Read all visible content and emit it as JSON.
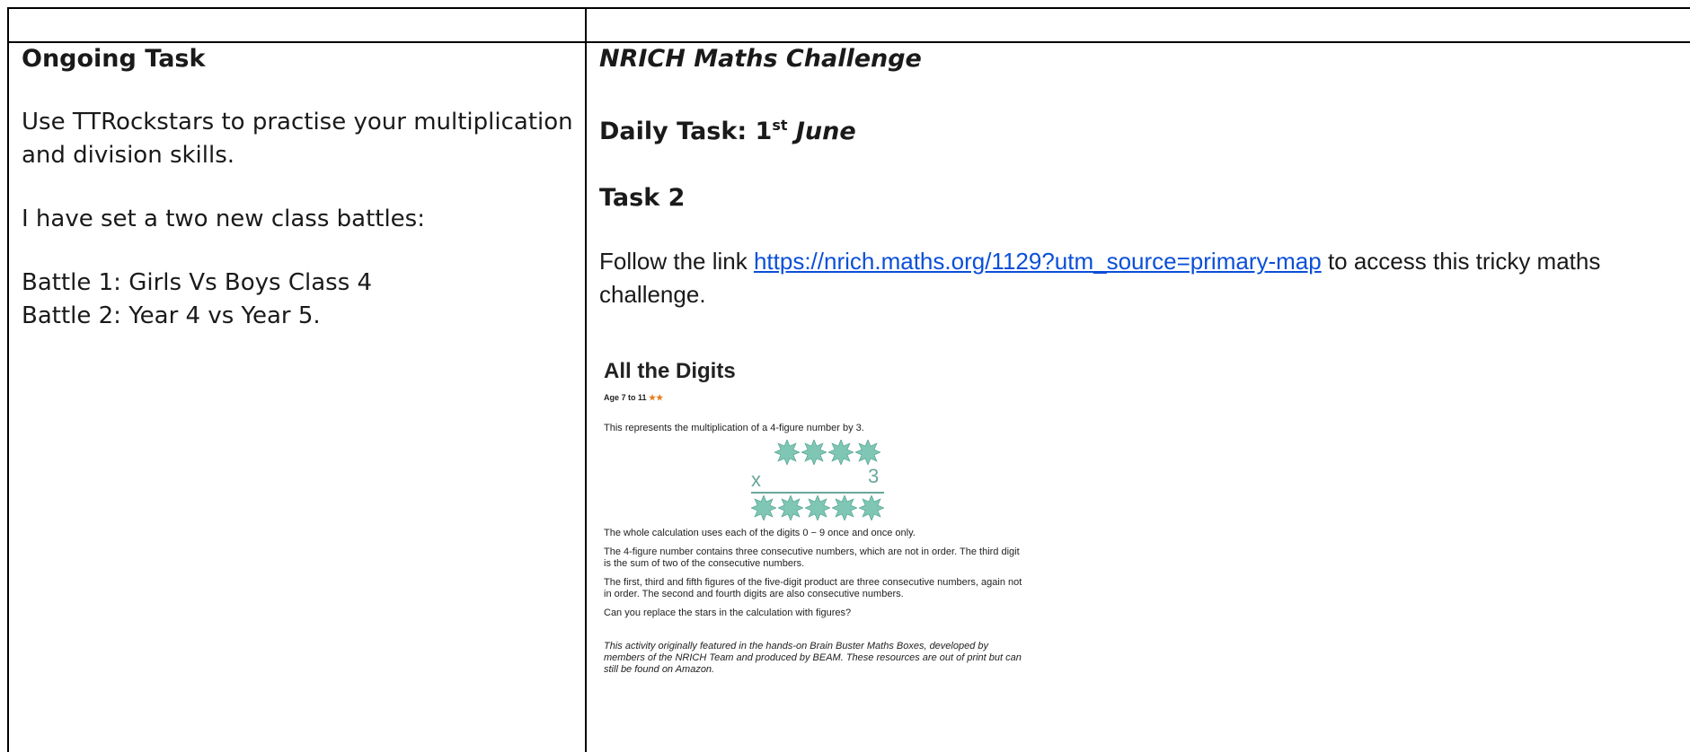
{
  "left": {
    "title": "Ongoing Task",
    "line1": "Use TTRockstars to practise your multiplication and division skills.",
    "line2": "I have set a two new class battles:",
    "battle1": "Battle 1: Girls Vs Boys Class 4",
    "battle2": "Battle 2: Year 4 vs Year 5."
  },
  "right": {
    "title": "NRICH Maths Challenge",
    "daily_prefix": "Daily Task: 1",
    "daily_sup": "st",
    "daily_suffix": " June",
    "task": "Task 2",
    "follow_prefix": "Follow the link ",
    "link": "https://nrich.maths.org/1129?utm_source=primary-map",
    "follow_suffix": " to access this tricky maths challenge."
  },
  "nrich": {
    "title": "All the Digits",
    "age": "Age 7 to 11",
    "stars": "★★",
    "intro": "This represents the multiplication of a 4-figure number by 3.",
    "calc_x": "x",
    "calc_multiplier": "3",
    "p1": "The whole calculation uses each of the digits 0 − 9 once and once only.",
    "p2": "The 4-figure number contains three consecutive numbers, which are not in order. The third digit is the sum of two of the consecutive numbers.",
    "p3": "The first, third and fifth figures of the five-digit product are three consecutive numbers, again not in order. The second and fourth digits are also consecutive numbers.",
    "p4": "Can you replace the stars in the calculation with figures?",
    "footnote": "This activity originally featured in the hands-on Brain Buster Maths Boxes, developed by members of the NRICH Team and produced by BEAM. These resources are out of print but can still be found on Amazon."
  },
  "colors": {
    "link": "#0b4fd9",
    "star_teal": "#7fc7b4",
    "age_star": "#e87a1d"
  }
}
